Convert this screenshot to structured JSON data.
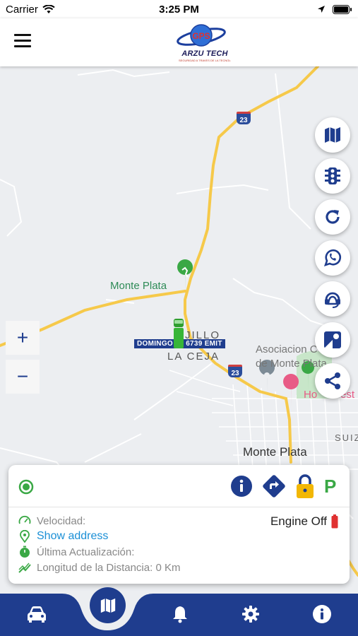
{
  "status_bar": {
    "carrier": "Carrier",
    "time": "3:25 PM"
  },
  "header": {
    "logo_text": "ARZU TECH",
    "logo_badge": "GPS",
    "logo_tagline": "SEGURIDAD A TRAVES DE LA TECNOLOGIA"
  },
  "map": {
    "labels": {
      "monte_plata_poi": "Monte Plata",
      "trujillo": "JILLO",
      "la_ceja": "LA CEJA",
      "asociacion_line1": "Asociacion C",
      "asociacion_line1_end": "a",
      "asociacion_line2": "de Monte Plata",
      "hotel": "Ho",
      "hotel_end": "est",
      "monte_plata_town": "Monte Plata",
      "suiz": "SUIZ",
      "route_23": "23"
    },
    "vehicle_label": "DOMINGO",
    "vehicle_plate": "6739 EMIT",
    "zoom_in": "+",
    "zoom_out": "−",
    "fab_buttons": [
      "map-type",
      "traffic",
      "refresh",
      "whatsapp",
      "support",
      "street-view",
      "share"
    ]
  },
  "info_panel": {
    "velocidad_label": "Velocidad:",
    "show_address": "Show address",
    "ultima_label": "Última Actualización:",
    "distance_label": "Longitud de la Distancia: 0 Km",
    "engine_status": "Engine Off",
    "parking_label": "P"
  },
  "nav": {
    "items": [
      "vehicles",
      "map",
      "notifications",
      "settings",
      "info"
    ],
    "active": "map"
  },
  "colors": {
    "primary": "#1f3d8e",
    "road": "#f6c94a",
    "accent_green": "#3aa845",
    "link": "#1a8fd6",
    "lock": "#f2b705",
    "battery": "#e03131"
  }
}
